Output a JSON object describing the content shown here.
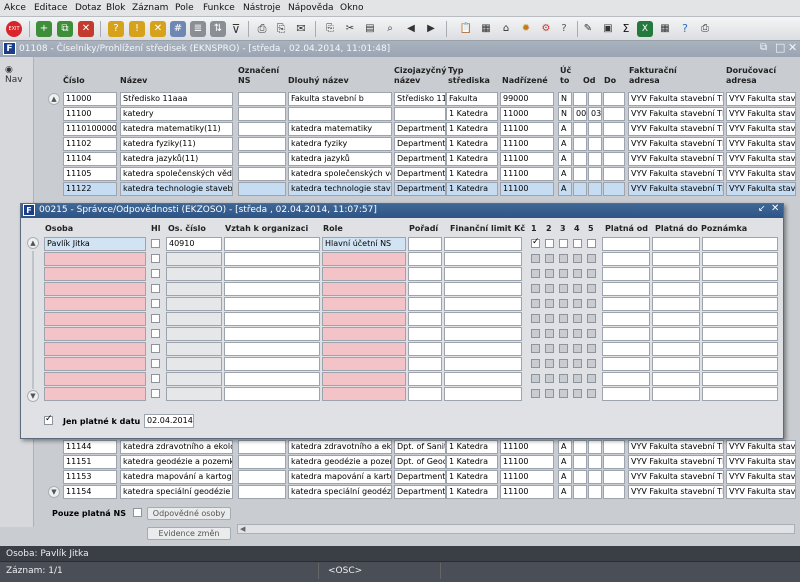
{
  "menu": [
    "Akce",
    "Editace",
    "Dotaz",
    "Blok",
    "Záznam",
    "Pole",
    "Funkce",
    "Nástroje",
    "Nápověda",
    "Okno"
  ],
  "main_window": {
    "title": "01108 - Číselníky/Prohlížení středisek (EKNSPRO) - [středa , 02.04.2014, 11:01:48]",
    "nav_label": "Nav",
    "columns": [
      "Číslo",
      "Název",
      "Označení NS",
      "Dlouhý název",
      "Cizojazyčný název",
      "Typ střediska",
      "Nadřízené",
      "Úč to",
      "Od",
      "Do",
      "Fakturační adresa",
      "Doručovací adresa"
    ],
    "rows_top": [
      {
        "cislo": "11000",
        "nazev": "Středisko 11aaa",
        "oznaceni": "",
        "dlouhy": "Fakulta stavební b",
        "cizi": "Středisko 11",
        "typ": "Fakulta",
        "nadr": "99000",
        "uc": "N",
        "od": "",
        "do": "",
        "fakt": "VYV Fakulta stavební Th",
        "dor": "VYV Fakulta stave"
      },
      {
        "cislo": "11100",
        "nazev": "katedry",
        "oznaceni": "",
        "dlouhy": "",
        "cizi": "",
        "typ": "1 Katedra",
        "nadr": "11000",
        "uc": "N",
        "od": "00",
        "do": "03",
        "fakt": "VYV Fakulta stavební Th",
        "dor": "VYV Fakulta stave"
      },
      {
        "cislo": "1110100000",
        "nazev": "katedra matematiky(11)",
        "oznaceni": "",
        "dlouhy": "katedra matematiky",
        "cizi": "Department",
        "typ": "1 Katedra",
        "nadr": "11100",
        "uc": "A",
        "od": "",
        "do": "",
        "fakt": "VYV Fakulta stavební Th",
        "dor": "VYV Fakulta stave"
      },
      {
        "cislo": "11102",
        "nazev": "katedra fyziky(11)",
        "oznaceni": "",
        "dlouhy": "katedra fyziky",
        "cizi": "Department",
        "typ": "1 Katedra",
        "nadr": "11100",
        "uc": "A",
        "od": "",
        "do": "",
        "fakt": "VYV Fakulta stavební Th",
        "dor": "VYV Fakulta stave"
      },
      {
        "cislo": "11104",
        "nazev": "katedra jazyků(11)",
        "oznaceni": "",
        "dlouhy": "katedra jazyků",
        "cizi": "Department",
        "typ": "1 Katedra",
        "nadr": "11100",
        "uc": "A",
        "od": "",
        "do": "",
        "fakt": "VYV Fakulta stavební Th",
        "dor": "VYV Fakulta stave"
      },
      {
        "cislo": "11105",
        "nazev": "katedra společenských věd",
        "oznaceni": "",
        "dlouhy": "katedra společenských věd",
        "cizi": "Department",
        "typ": "1 Katedra",
        "nadr": "11100",
        "uc": "A",
        "od": "",
        "do": "",
        "fakt": "VYV Fakulta stavební Th",
        "dor": "VYV Fakulta stave"
      },
      {
        "cislo": "11122",
        "nazev": "katedra technologie staveb",
        "oznaceni": "",
        "dlouhy": "katedra technologie staveb",
        "cizi": "Department",
        "typ": "1 Katedra",
        "nadr": "11100",
        "uc": "A",
        "od": "",
        "do": "",
        "fakt": "VYV Fakulta stavební Th",
        "dor": "VYV Fakulta stave"
      }
    ],
    "rows_bottom": [
      {
        "cislo": "11144",
        "nazev": "katedra zdravotního a ekolo",
        "dlouhy": "katedra zdravotního a ekol",
        "cizi": "Dpt. of Sanit",
        "typ": "1 Katedra",
        "nadr": "11100",
        "uc": "A",
        "fakt": "VYV Fakulta stavební Th",
        "dor": "VYV Fakulta stave"
      },
      {
        "cislo": "11151",
        "nazev": "katedra geodézie a pozemko",
        "dlouhy": "katedra geodézie a pozemk",
        "cizi": "Dpt. of Geod",
        "typ": "1 Katedra",
        "nadr": "11100",
        "uc": "A",
        "fakt": "VYV Fakulta stavební Th",
        "dor": "VYV Fakulta stave"
      },
      {
        "cislo": "11153",
        "nazev": "katedra mapování a kartogra",
        "dlouhy": "katedra mapování a kartogr",
        "cizi": "Department",
        "typ": "1 Katedra",
        "nadr": "11100",
        "uc": "A",
        "fakt": "VYV Fakulta stavební Th",
        "dor": "VYV Fakulta stave"
      },
      {
        "cislo": "11154",
        "nazev": "katedra speciální geodézie",
        "dlouhy": "katedra speciální geodézie",
        "cizi": "Department",
        "typ": "1 Katedra",
        "nadr": "11100",
        "uc": "A",
        "fakt": "VYV Fakulta stavební Th",
        "dor": "VYV Fakulta stave"
      }
    ],
    "only_valid_ns_label": "Pouze platná NS",
    "btn_responsible": "Odpovědné osoby",
    "btn_evidence": "Evidence změn"
  },
  "dialog": {
    "title": "00215 - Správce/Odpovědnosti (EKZOSO) - [středa , 02.04.2014, 11:07:57]",
    "columns": [
      "Osoba",
      "Hl",
      "Os. číslo",
      "Vztah k organizaci",
      "Role",
      "Pořadí",
      "Finanční limit Kč",
      "1",
      "2",
      "3",
      "4",
      "5",
      "Platná od",
      "Platná do",
      "Poznámka"
    ],
    "row1": {
      "osoba": "Pavlík Jitka",
      "os_cislo": "40910",
      "vztah": "",
      "role": "Hlavní účetní NS"
    },
    "only_valid_label": "Jen platné k datu",
    "only_valid_date": "02.04.2014"
  },
  "status": {
    "line1": "Osoba: Pavlík Jitka",
    "line2": "Záznam: 1/1",
    "osc": "<OSC>"
  }
}
